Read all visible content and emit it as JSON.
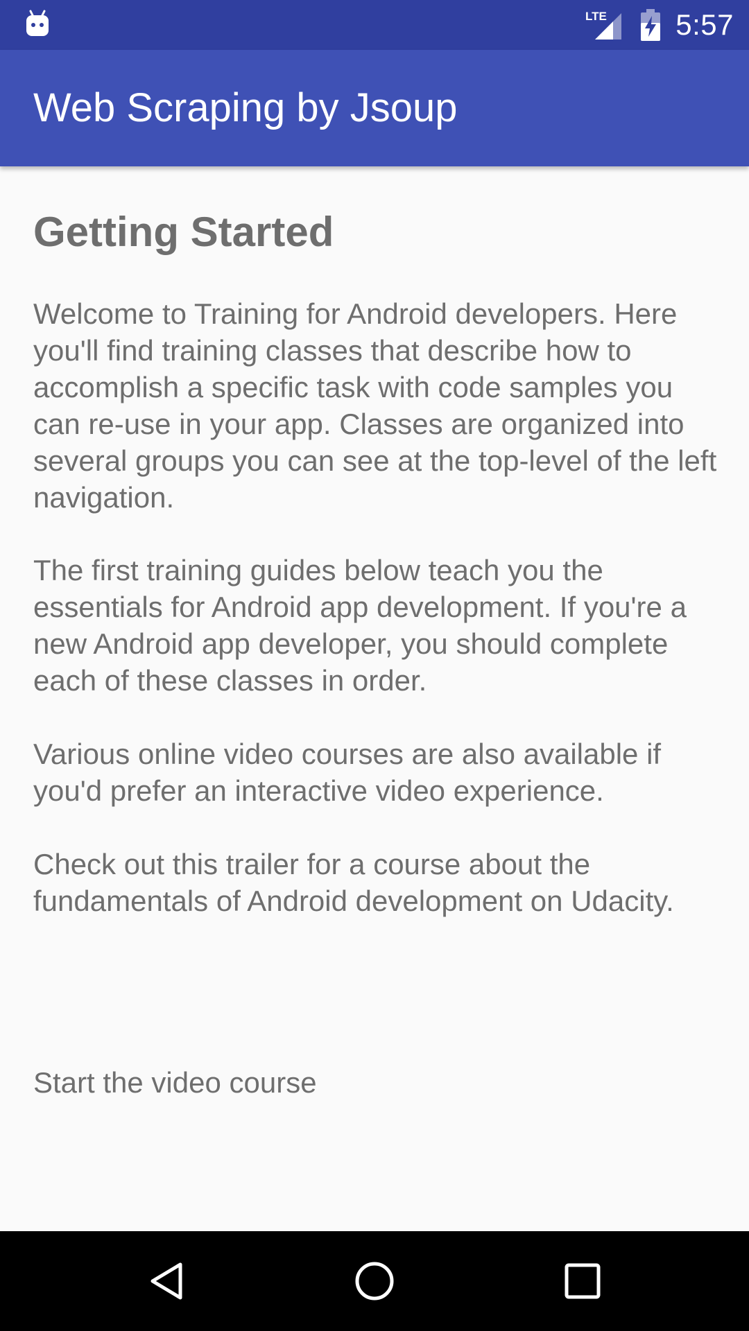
{
  "status_bar": {
    "network": "LTE",
    "time": "5:57",
    "left_icon": "android-notification-icon",
    "signal_icon": "lte-signal-icon",
    "battery_icon": "battery-charging-icon"
  },
  "app_bar": {
    "title": "Web Scraping by Jsoup",
    "background": "#3F51B5",
    "status_background": "#303F9F"
  },
  "content": {
    "title": "Getting Started",
    "paragraphs": [
      "Welcome to Training for Android developers. Here you'll find training classes that describe how to accomplish a specific task with code samples you can re-use in your app. Classes are organized into several groups you can see at the top-level of the left navigation.",
      "The first training guides below teach you the essentials for Android app development. If you're a new Android app developer, you should complete each of these classes in order.",
      "Various online video courses are also available if you'd prefer an interactive video experience.",
      "Check out this trailer for a course about the fundamentals of Android development on Udacity."
    ],
    "video_link": "Start the video course"
  },
  "nav_bar": {
    "back_icon": "back-triangle-icon",
    "home_icon": "home-circle-icon",
    "recents_icon": "recents-square-icon"
  }
}
